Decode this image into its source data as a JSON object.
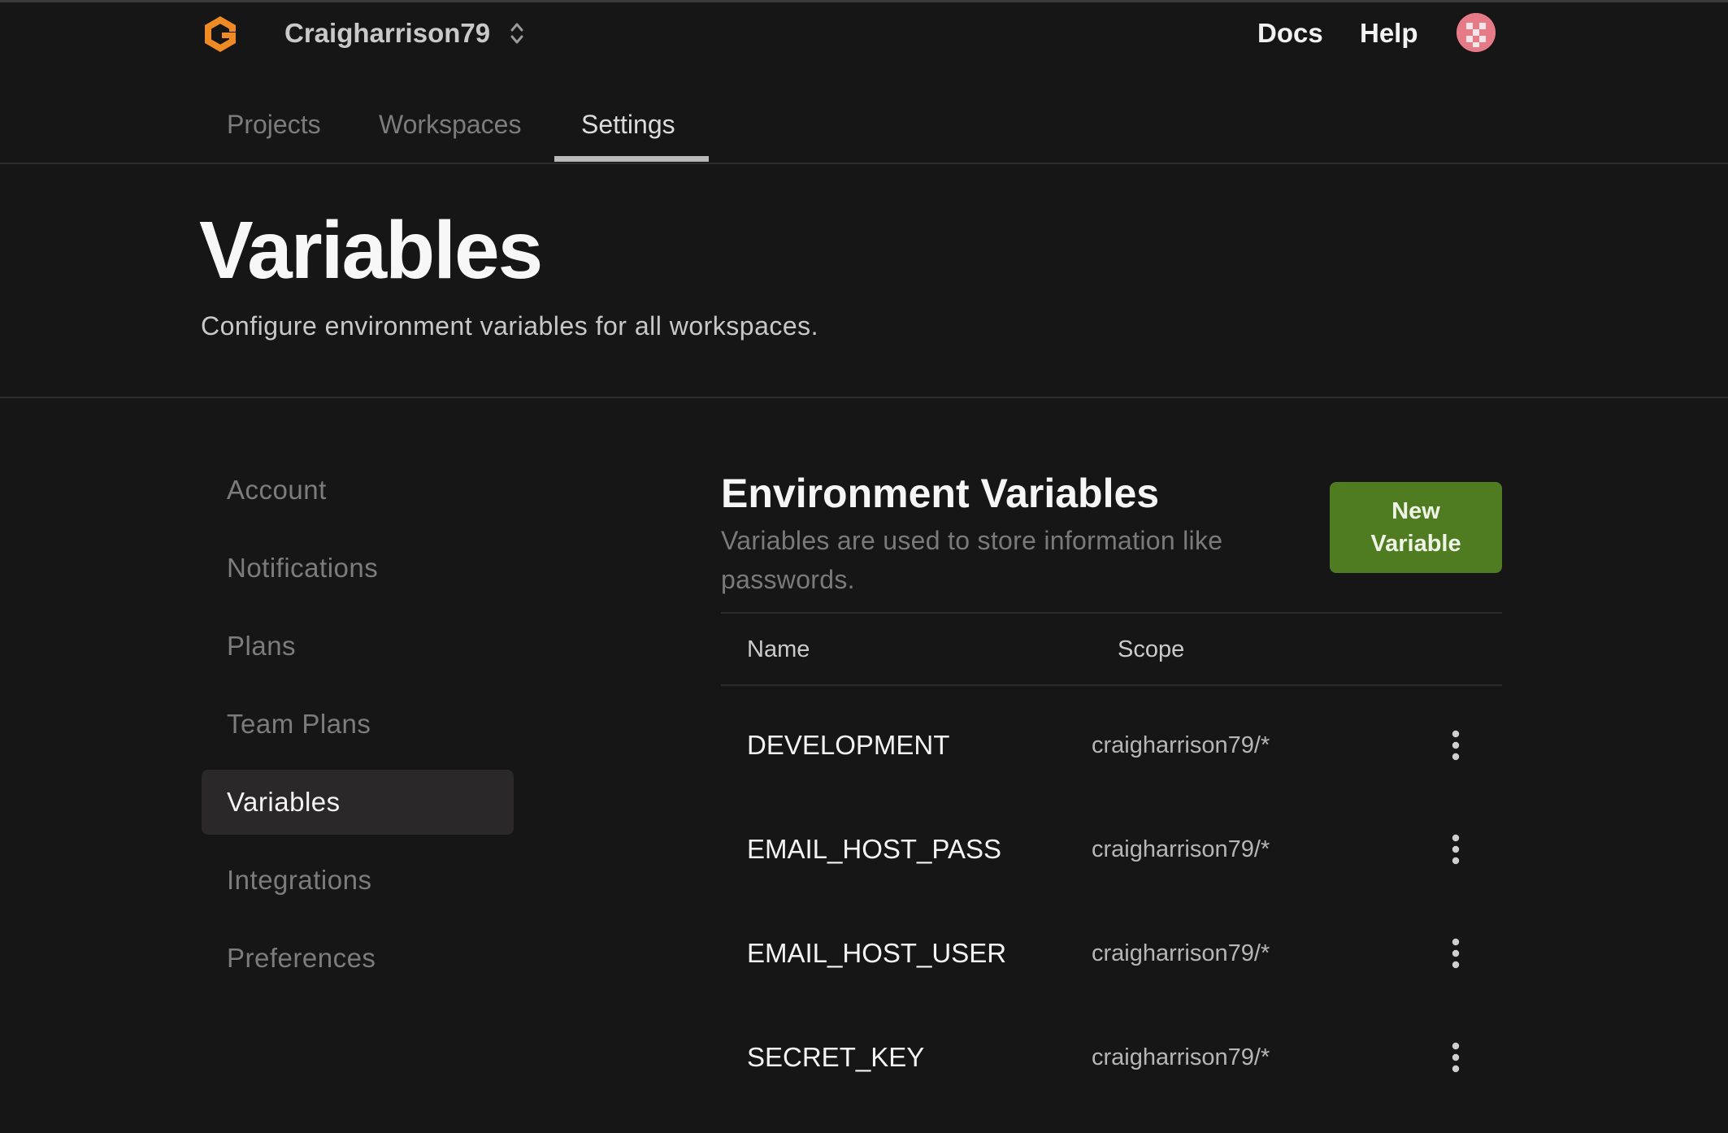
{
  "topbar": {
    "workspace_name": "Craigharrison79",
    "docs_label": "Docs",
    "help_label": "Help"
  },
  "tabs": [
    {
      "label": "Projects",
      "active": false
    },
    {
      "label": "Workspaces",
      "active": false
    },
    {
      "label": "Settings",
      "active": true
    }
  ],
  "header": {
    "title": "Variables",
    "subtitle": "Configure environment variables for all workspaces."
  },
  "sidebar": {
    "items": [
      {
        "label": "Account",
        "active": false
      },
      {
        "label": "Notifications",
        "active": false
      },
      {
        "label": "Plans",
        "active": false
      },
      {
        "label": "Team Plans",
        "active": false
      },
      {
        "label": "Variables",
        "active": true
      },
      {
        "label": "Integrations",
        "active": false
      },
      {
        "label": "Preferences",
        "active": false
      }
    ]
  },
  "section": {
    "title": "Environment Variables",
    "description": "Variables are used to store information like passwords.",
    "new_button_label": "New Variable",
    "columns": {
      "name": "Name",
      "scope": "Scope"
    },
    "rows": [
      {
        "name": "DEVELOPMENT",
        "scope": "craigharrison79/*"
      },
      {
        "name": "EMAIL_HOST_PASS",
        "scope": "craigharrison79/*"
      },
      {
        "name": "EMAIL_HOST_USER",
        "scope": "craigharrison79/*"
      },
      {
        "name": "SECRET_KEY",
        "scope": "craigharrison79/*"
      }
    ]
  },
  "colors": {
    "background": "#161616",
    "accent_orange": "#f08a24",
    "button_green": "#4f7b21",
    "avatar_pink": "#e57b87"
  },
  "icons": {
    "logo": "gitpod-logo-icon",
    "workspace_switch": "chevron-up-down-icon",
    "row_menu": "more-vertical-icon"
  }
}
